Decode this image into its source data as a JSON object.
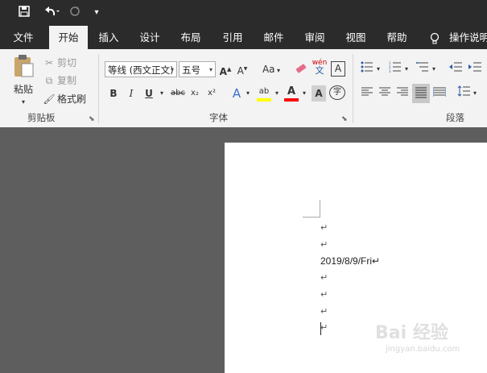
{
  "quick_access": {
    "save_icon": "save-icon",
    "undo_icon": "undo-icon",
    "redo_icon": "redo-icon",
    "customize_icon": "customize-qat-icon"
  },
  "tabs": [
    {
      "label": "文件"
    },
    {
      "label": "开始",
      "active": true
    },
    {
      "label": "插入"
    },
    {
      "label": "设计"
    },
    {
      "label": "布局"
    },
    {
      "label": "引用"
    },
    {
      "label": "邮件"
    },
    {
      "label": "审阅"
    },
    {
      "label": "视图"
    },
    {
      "label": "帮助"
    },
    {
      "label": "操作说明"
    }
  ],
  "clipboard": {
    "group_label": "剪贴板",
    "paste": "粘贴",
    "cut": "剪切",
    "copy": "复制",
    "format_painter": "格式刷"
  },
  "font": {
    "group_label": "字体",
    "font_name": "等线 (西文正文)",
    "font_size": "五号",
    "case_label": "Aa",
    "phonetic_label": "wén",
    "border_label": "A",
    "bold": "B",
    "italic": "I",
    "underline": "U",
    "strikethrough": "abc",
    "subscript": "x₂",
    "superscript": "x²",
    "text_effects": "A",
    "highlight": "ab",
    "font_color": "A",
    "char_shading": "A",
    "enclose": "字",
    "highlight_color": "#ffff00",
    "font_color_value": "#ff0000"
  },
  "paragraph": {
    "group_label": "段落"
  },
  "document": {
    "marks": [
      "↵",
      "↵",
      "↵",
      "↵",
      "↵",
      "↵"
    ],
    "date_text": "2019/8/9/Fri↵"
  },
  "watermark": {
    "brand": "Bai 经验",
    "url": "jingyan.baidu.com"
  }
}
